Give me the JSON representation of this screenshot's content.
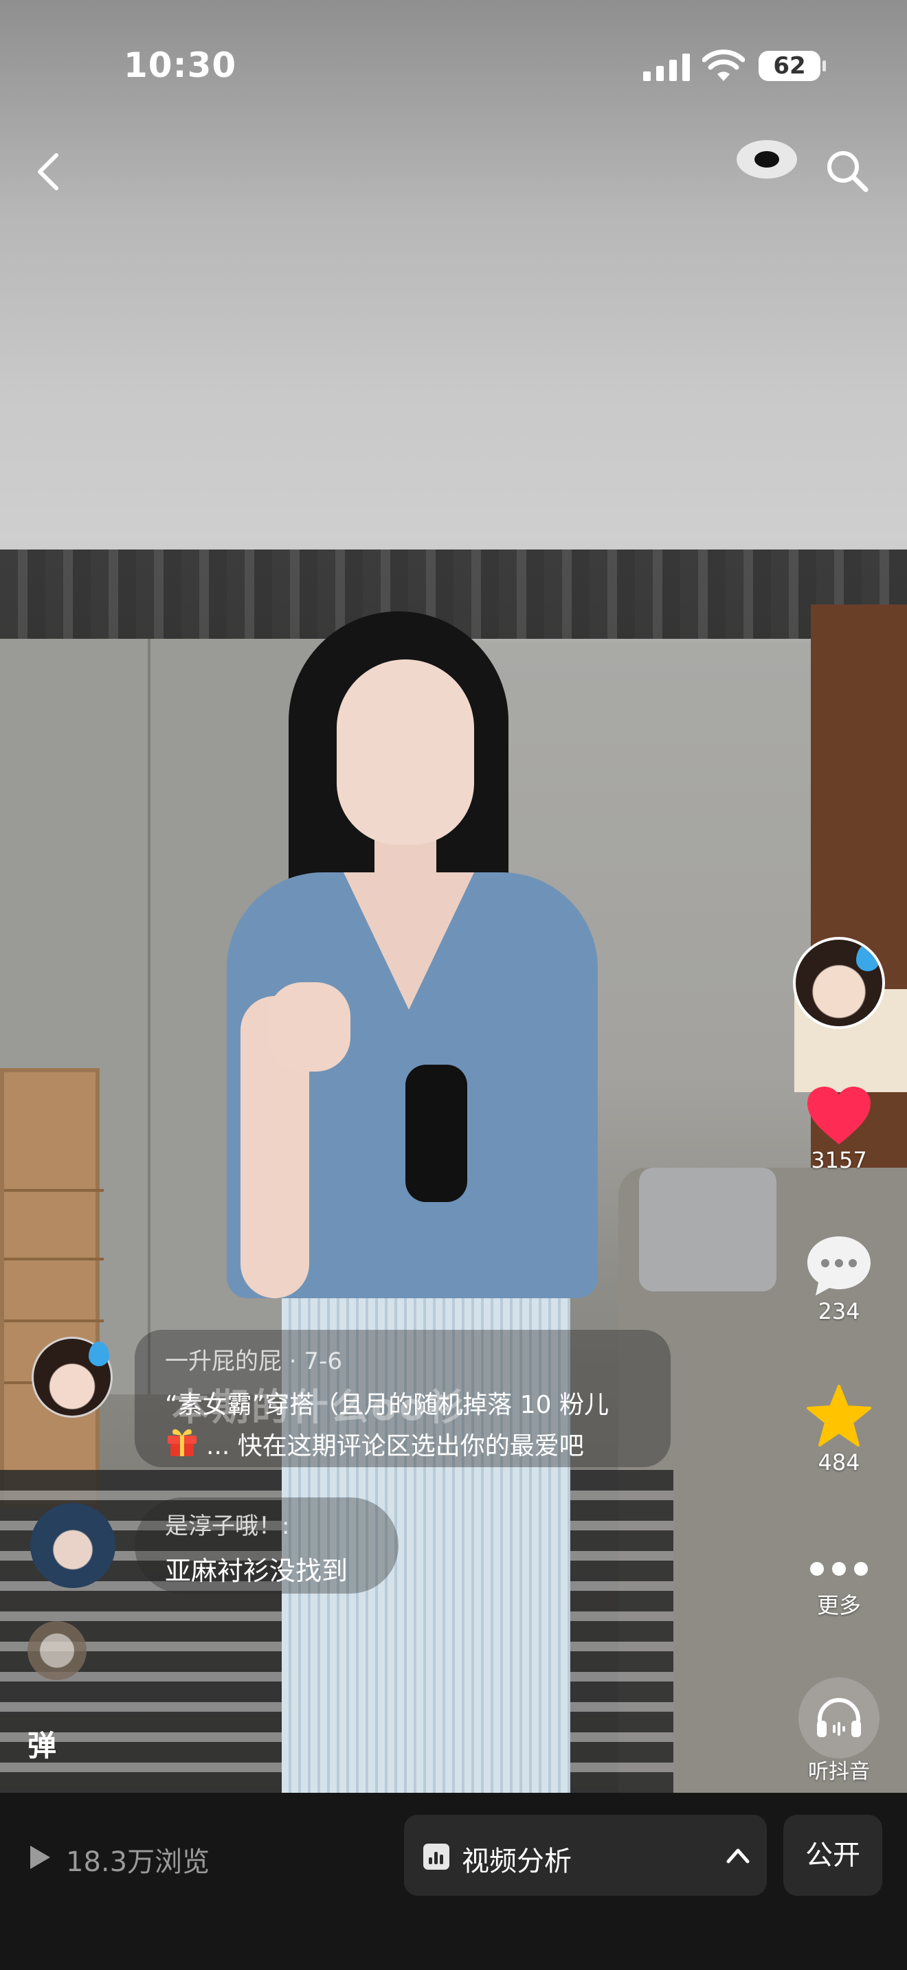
{
  "status_bar": {
    "time": "10:30",
    "battery": "62"
  },
  "nav": {
    "back_icon": "chevron-left-icon",
    "search_icon": "search-icon"
  },
  "rail": {
    "like_count": "3157",
    "comment_count": "234",
    "favorite_count": "484",
    "more_label": "更多",
    "listen_label": "听抖音",
    "like_color": "#fe2c55",
    "favorite_color": "#ffc300"
  },
  "post": {
    "author_meta": "一升屁的屁 · 7-6",
    "caption_line1": "“素女霸”穿搭（且月的随机掉落 10 粉儿",
    "caption_ghost": "本期的什么oo衫",
    "caption_line2": "... 快在这期评论区选出你的最爱吧"
  },
  "reply": {
    "name": "是淳子哦！:",
    "text": "亚麻衬衫没找到"
  },
  "danmu": {
    "toggle_label": "弹"
  },
  "bottom_bar": {
    "views": "18.3万浏览",
    "analysis_label": "视频分析",
    "public_label": "公开"
  }
}
